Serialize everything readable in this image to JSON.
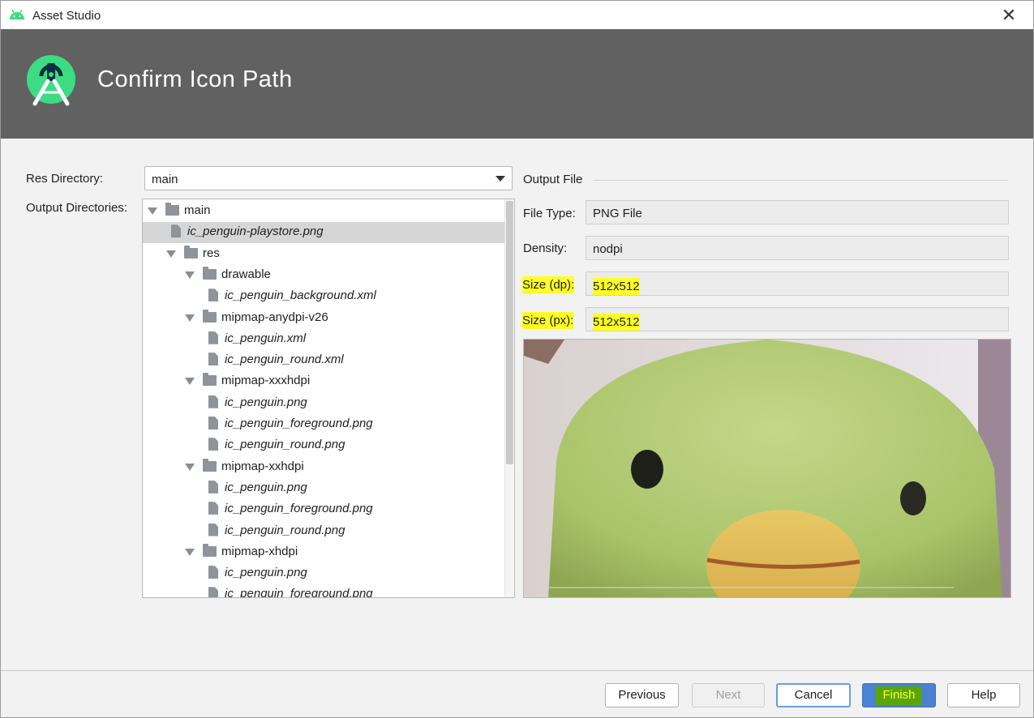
{
  "window": {
    "title": "Asset Studio"
  },
  "header": {
    "title": "Confirm Icon Path"
  },
  "form": {
    "res_directory_label": "Res Directory:",
    "res_directory_value": "main",
    "output_directories_label": "Output Directories:"
  },
  "tree": [
    {
      "label": "main",
      "kind": "folder",
      "depth": 0,
      "expanded": true,
      "italic": false,
      "selected": false
    },
    {
      "label": "ic_penguin-playstore.png",
      "kind": "file",
      "depth": 1,
      "italic": true,
      "selected": true
    },
    {
      "label": "res",
      "kind": "folder",
      "depth": 1,
      "expanded": true,
      "italic": false,
      "selected": false
    },
    {
      "label": "drawable",
      "kind": "folder",
      "depth": 2,
      "expanded": true,
      "italic": false,
      "selected": false
    },
    {
      "label": "ic_penguin_background.xml",
      "kind": "file",
      "depth": 3,
      "italic": true,
      "selected": false
    },
    {
      "label": "mipmap-anydpi-v26",
      "kind": "folder",
      "depth": 2,
      "expanded": true,
      "italic": false,
      "selected": false
    },
    {
      "label": "ic_penguin.xml",
      "kind": "file",
      "depth": 3,
      "italic": true,
      "selected": false
    },
    {
      "label": "ic_penguin_round.xml",
      "kind": "file",
      "depth": 3,
      "italic": true,
      "selected": false
    },
    {
      "label": "mipmap-xxxhdpi",
      "kind": "folder",
      "depth": 2,
      "expanded": true,
      "italic": false,
      "selected": false
    },
    {
      "label": "ic_penguin.png",
      "kind": "file",
      "depth": 3,
      "italic": true,
      "selected": false
    },
    {
      "label": "ic_penguin_foreground.png",
      "kind": "file",
      "depth": 3,
      "italic": true,
      "selected": false
    },
    {
      "label": "ic_penguin_round.png",
      "kind": "file",
      "depth": 3,
      "italic": true,
      "selected": false
    },
    {
      "label": "mipmap-xxhdpi",
      "kind": "folder",
      "depth": 2,
      "expanded": true,
      "italic": false,
      "selected": false
    },
    {
      "label": "ic_penguin.png",
      "kind": "file",
      "depth": 3,
      "italic": true,
      "selected": false
    },
    {
      "label": "ic_penguin_foreground.png",
      "kind": "file",
      "depth": 3,
      "italic": true,
      "selected": false
    },
    {
      "label": "ic_penguin_round.png",
      "kind": "file",
      "depth": 3,
      "italic": true,
      "selected": false
    },
    {
      "label": "mipmap-xhdpi",
      "kind": "folder",
      "depth": 2,
      "expanded": true,
      "italic": false,
      "selected": false
    },
    {
      "label": "ic_penguin.png",
      "kind": "file",
      "depth": 3,
      "italic": true,
      "selected": false
    },
    {
      "label": "ic_penguin_foreground.png",
      "kind": "file",
      "depth": 3,
      "italic": true,
      "selected": false
    }
  ],
  "output": {
    "section_label": "Output File",
    "file_type_label": "File Type:",
    "file_type_value": "PNG File",
    "density_label": "Density:",
    "density_value": "nodpi",
    "size_dp_label": "Size (dp):",
    "size_dp_value": "512x512",
    "size_px_label": "Size (px):",
    "size_px_value": "512x512"
  },
  "buttons": {
    "previous": "Previous",
    "next": "Next",
    "cancel": "Cancel",
    "finish": "Finish",
    "help": "Help"
  },
  "colors": {
    "banner": "#616161",
    "highlight": "#ffff22",
    "finish_button": "#4b82d1",
    "android_green": "#3ddc84"
  }
}
